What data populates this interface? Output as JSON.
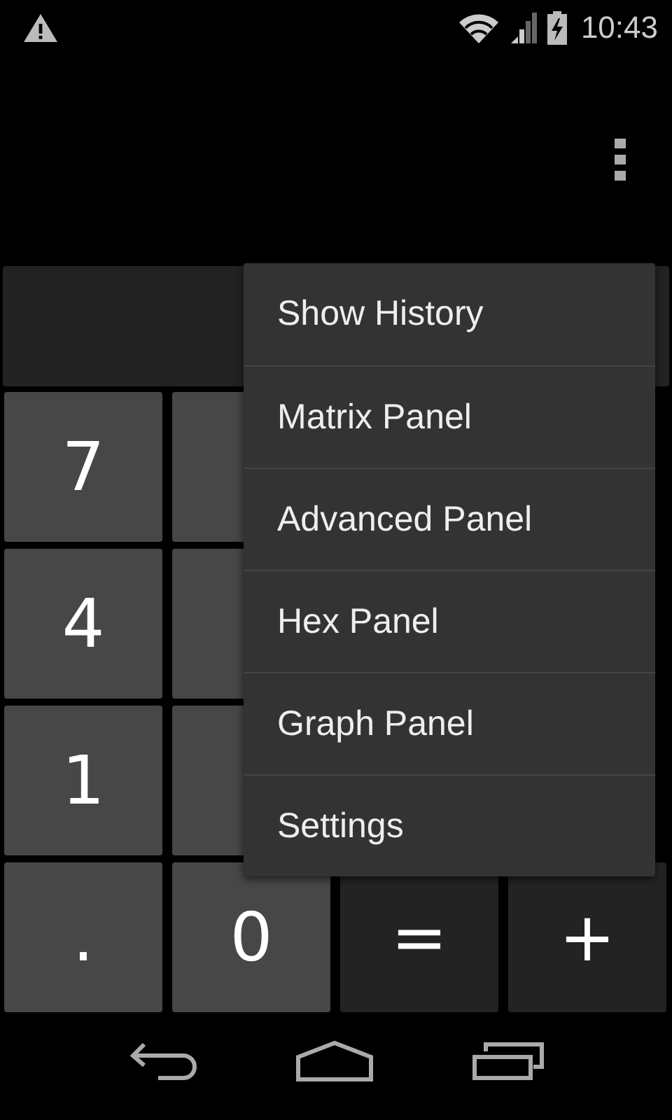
{
  "status_bar": {
    "time": "10:43"
  },
  "keypad": {
    "rows": [
      [
        {
          "label": "7",
          "kind": "digit"
        },
        {
          "kind": "digit"
        }
      ],
      [
        {
          "label": "4",
          "kind": "digit"
        },
        {
          "kind": "digit"
        }
      ],
      [
        {
          "label": "1",
          "kind": "digit"
        },
        {
          "kind": "digit"
        }
      ],
      [
        {
          "label": ".",
          "kind": "digit"
        },
        {
          "label": "0",
          "kind": "digit"
        },
        {
          "label": "=",
          "kind": "operator"
        },
        {
          "label": "+",
          "kind": "operator"
        }
      ]
    ]
  },
  "menu": {
    "items": [
      "Show History",
      "Matrix Panel",
      "Advanced Panel",
      "Hex Panel",
      "Graph Panel",
      "Settings"
    ]
  }
}
